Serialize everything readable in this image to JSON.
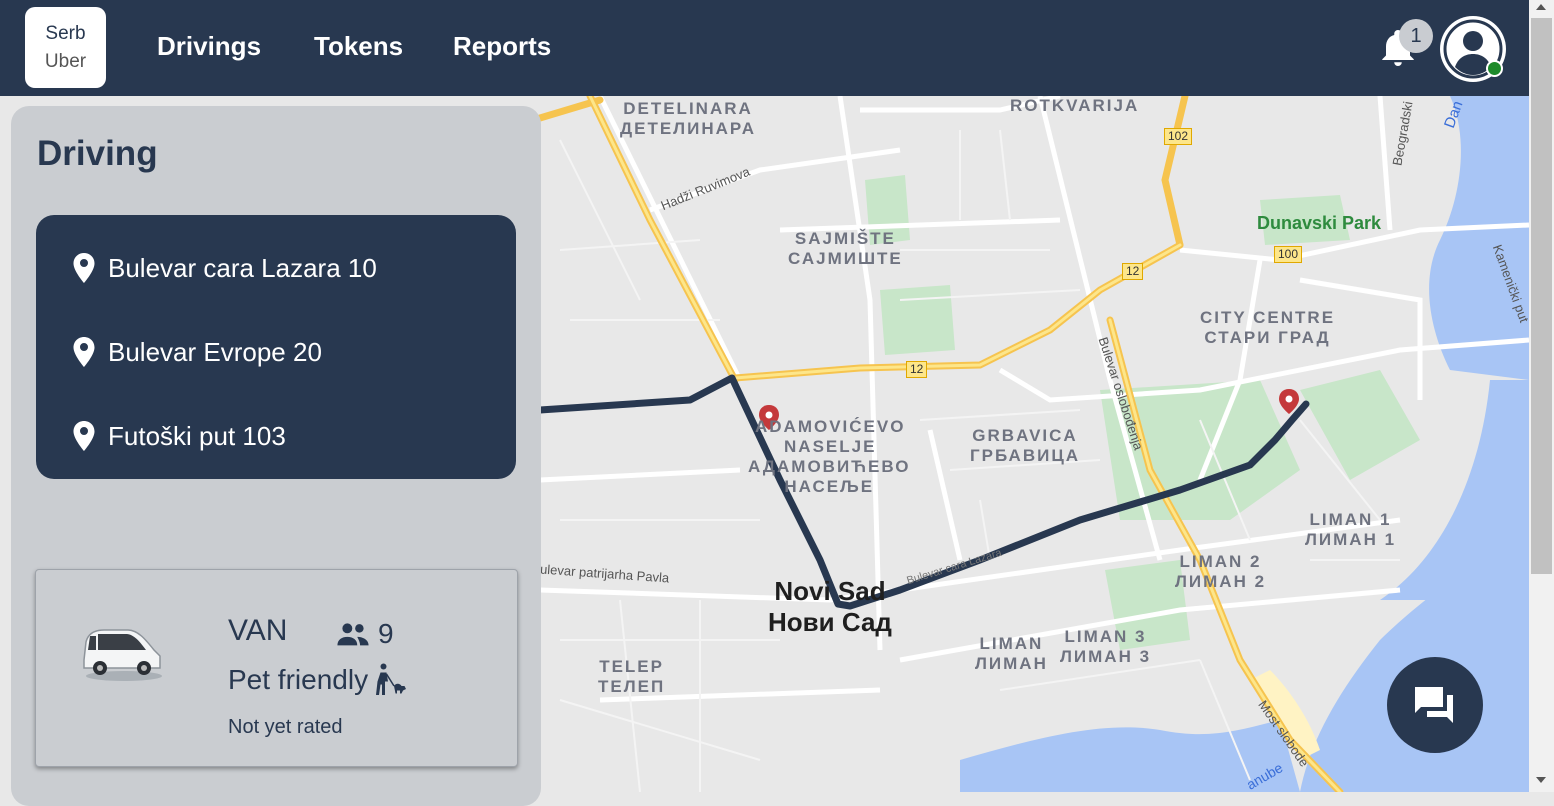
{
  "brand": {
    "line1": "Serb",
    "line2": "Uber"
  },
  "nav": {
    "drivings": "Drivings",
    "tokens": "Tokens",
    "reports": "Reports"
  },
  "notifications": {
    "count": "1"
  },
  "driving": {
    "title": "Driving",
    "stops": [
      "Bulevar cara Lazara 10",
      "Bulevar Evrope 20",
      "Futoški put 103"
    ]
  },
  "vehicle": {
    "type": "VAN",
    "seats": "9",
    "pet": "Pet friendly",
    "rating": "Not yet rated"
  },
  "map": {
    "areas": [
      {
        "l1": "DETELINARA",
        "l2": "ДЕТЕЛИНАРА"
      },
      {
        "l1": "ROTKVARIJA",
        "l2": ""
      },
      {
        "l1": "SAJMIŠTE",
        "l2": "САЈМИШТЕ"
      },
      {
        "l1": "CITY CENTRE",
        "l2": "СТАРИ ГРАД"
      },
      {
        "l1": "ADAMOVIĆEVO",
        "l2": "NASELJE"
      },
      {
        "l1": "АДАМОВИЋЕВО",
        "l2": "НАСЕЉЕ"
      },
      {
        "l1": "GRBAVICA",
        "l2": "ГРБАВИЦА"
      },
      {
        "l1": "LIMAN 1",
        "l2": "ЛИМАН 1"
      },
      {
        "l1": "LIMAN 2",
        "l2": "ЛИМАН 2"
      },
      {
        "l1": "LIMAN",
        "l2": "ЛИМАН"
      },
      {
        "l1": "LIMAN 3",
        "l2": "ЛИМАН 3"
      },
      {
        "l1": "TELEP",
        "l2": "ТЕЛЕП"
      }
    ],
    "city": {
      "l1": "Novi Sad",
      "l2": "Нови Сад"
    },
    "park": "Dunavski Park",
    "streets": {
      "hadzi": "Hadži Ruvimova",
      "oslobodjenja": "Bulevar oslobođenja",
      "patrijarha": "ulevar patrijarha Pavla",
      "most": "Most slobode",
      "kamenicki": "Kamenički put",
      "beogradski": "Beogradski",
      "dan": "Dan",
      "danube": "anube",
      "caraLazara": "Bulevar cara Lazara"
    },
    "roads": [
      "102",
      "100",
      "12",
      "12"
    ]
  },
  "colors": {
    "primary": "#283850",
    "panel": "#cacdd1",
    "river": "#a8c5f5",
    "road": "#fbd66a",
    "park": "#c8e6c9",
    "online": "#1d8a2a",
    "pin": "#c4393b"
  }
}
